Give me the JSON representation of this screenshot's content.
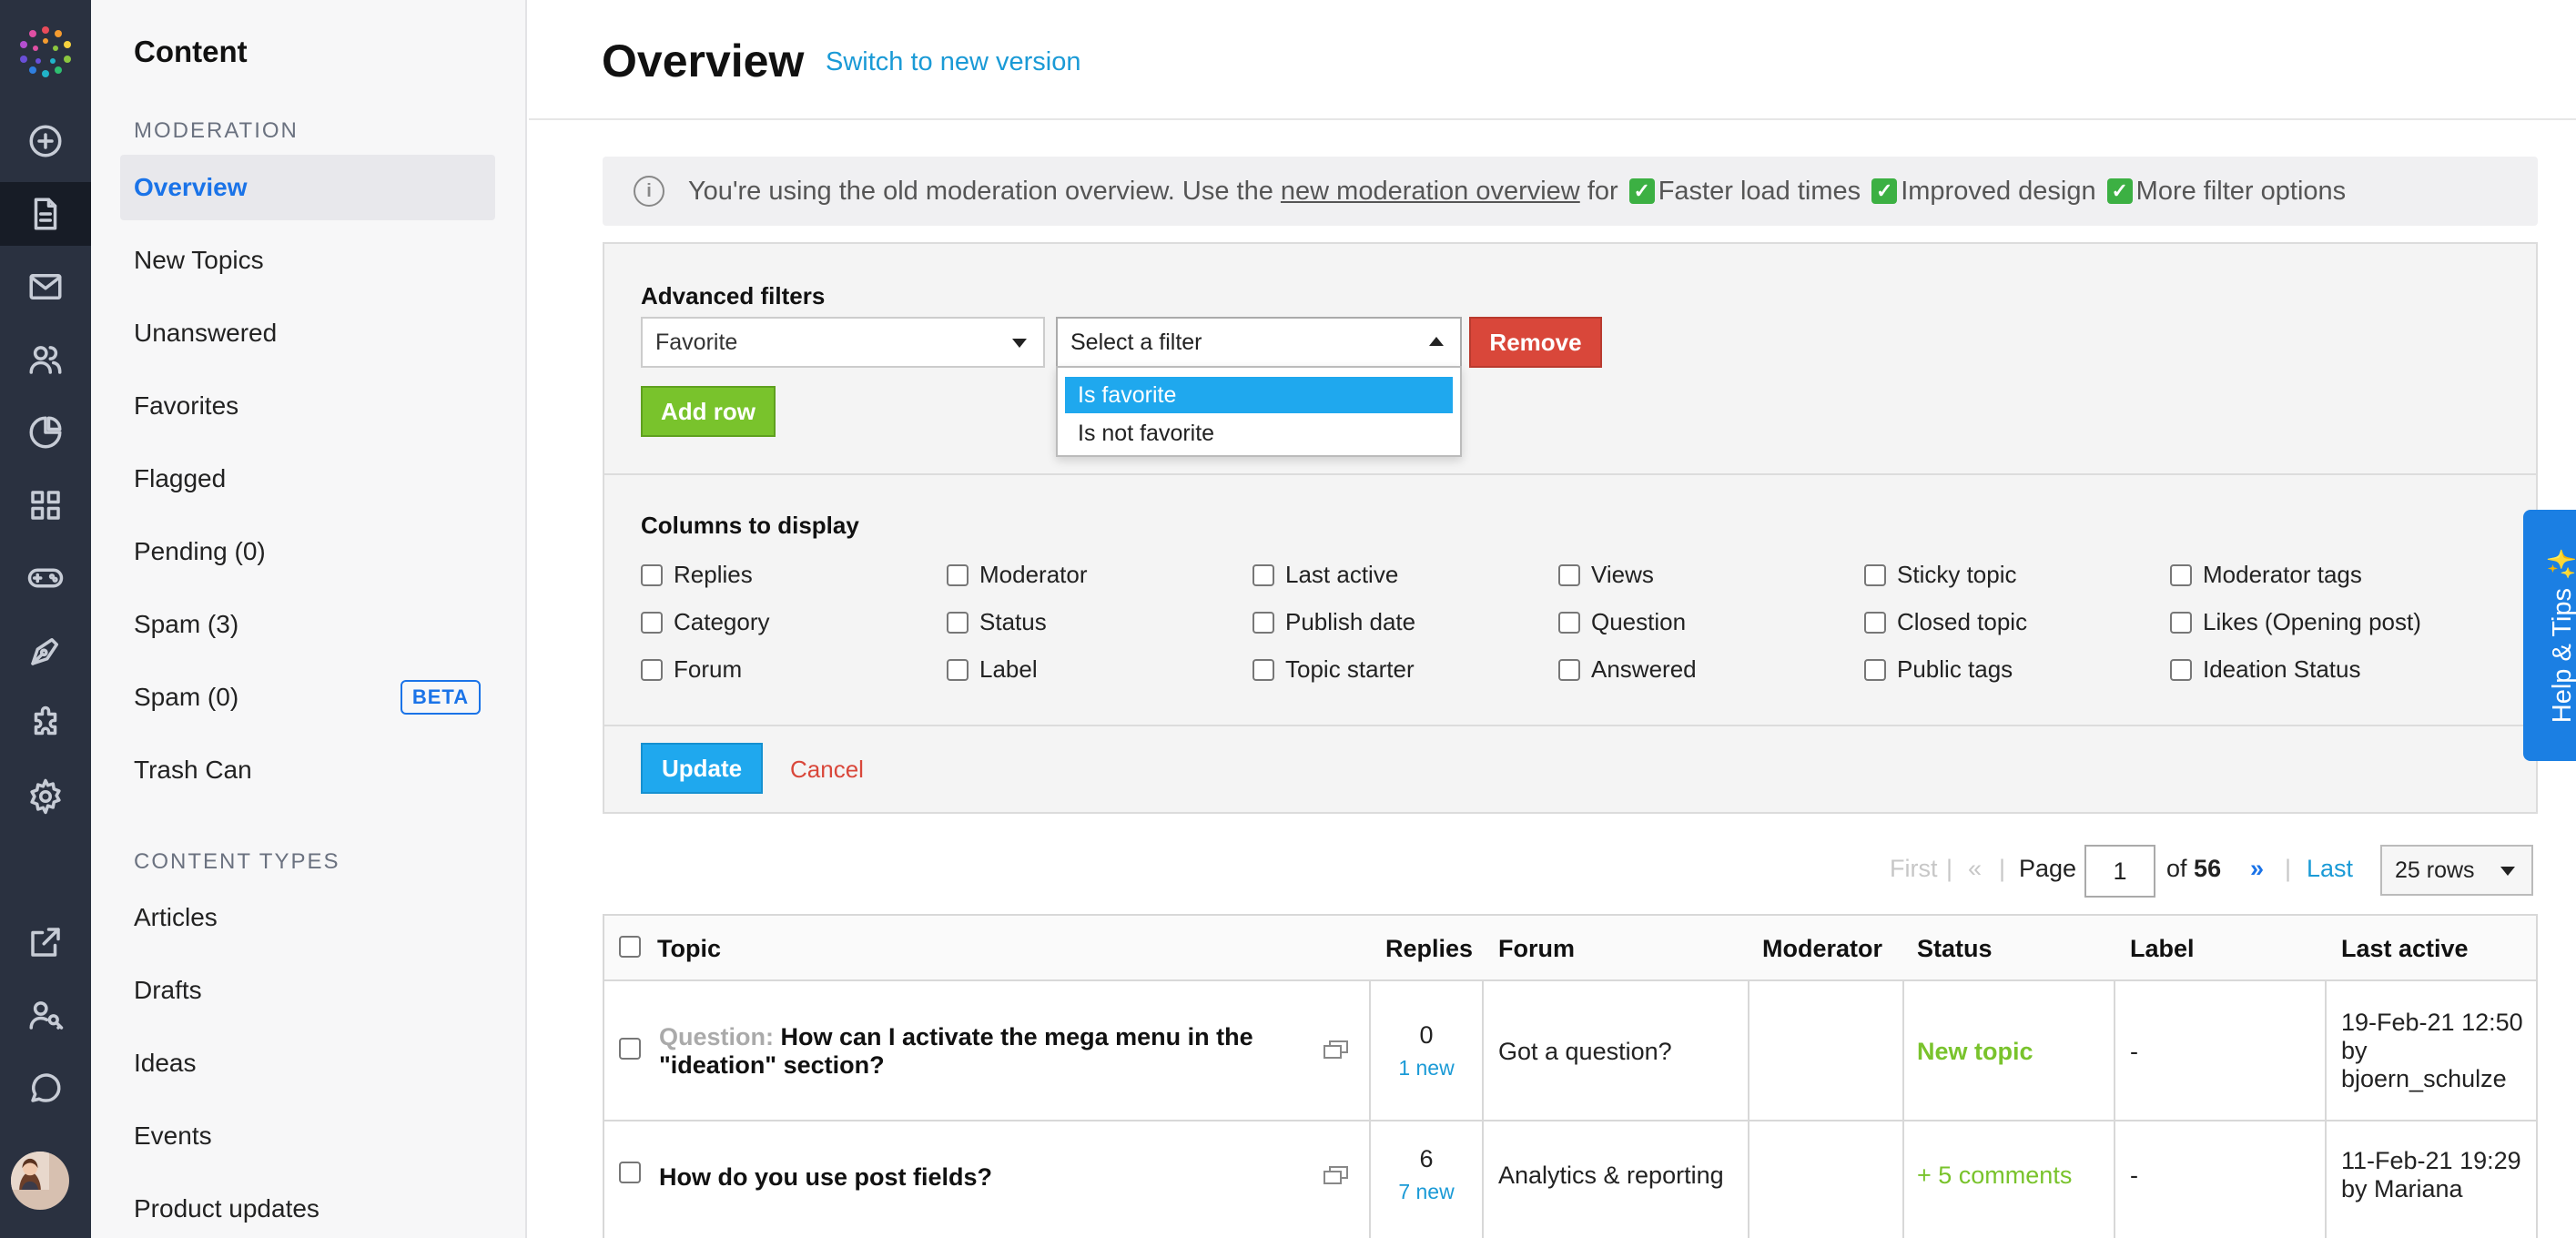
{
  "sidenav": {
    "title": "Content",
    "section_moderation": "MODERATION",
    "items": [
      {
        "label": "Overview"
      },
      {
        "label": "New Topics"
      },
      {
        "label": "Unanswered"
      },
      {
        "label": "Favorites"
      },
      {
        "label": "Flagged"
      },
      {
        "label": "Pending (0)"
      },
      {
        "label": "Spam (3)"
      },
      {
        "label": "Spam (0)",
        "badge": "BETA"
      },
      {
        "label": "Trash Can"
      }
    ],
    "section_types": "CONTENT TYPES",
    "types": [
      {
        "label": "Articles"
      },
      {
        "label": "Drafts"
      },
      {
        "label": "Ideas"
      },
      {
        "label": "Events"
      },
      {
        "label": "Product updates"
      }
    ]
  },
  "rail_icons": [
    "logo-icon",
    "plus-circle-icon",
    "document-icon",
    "mail-icon",
    "users-icon",
    "pie-chart-icon",
    "grid-icon",
    "gamepad-icon",
    "pen-icon",
    "puzzle-icon",
    "gear-icon",
    "external-link-icon",
    "user-key-icon",
    "chat-icon"
  ],
  "header": {
    "title": "Overview",
    "switch_link": "Switch to new version"
  },
  "notice": {
    "prefix": "You're using the old moderation overview. Use the",
    "link": "new moderation overview",
    "for": "for",
    "benefits": [
      "Faster load times",
      "Improved design",
      "More filter options"
    ],
    "check_glyph": "✓"
  },
  "filters": {
    "heading": "Advanced filters",
    "field_select": "Favorite",
    "value_select": "Select a filter",
    "options": [
      "Is favorite",
      "Is not favorite"
    ],
    "remove": "Remove",
    "add_row": "Add row",
    "columns_heading": "Columns to display",
    "columns": [
      [
        "Replies",
        "Category",
        "Forum"
      ],
      [
        "Moderator",
        "Status",
        "Label"
      ],
      [
        "Last active",
        "Publish date",
        "Topic starter"
      ],
      [
        "Views",
        "Question",
        "Answered"
      ],
      [
        "Sticky topic",
        "Closed topic",
        "Public tags"
      ],
      [
        "Moderator tags",
        "Likes (Opening post)",
        "Ideation Status"
      ]
    ],
    "update": "Update",
    "cancel": "Cancel"
  },
  "pager": {
    "first": "First",
    "prev": "«",
    "page_label": "Page",
    "page": "1",
    "of_label": "of",
    "total": "56",
    "next": "»",
    "last": "Last",
    "rows": "25 rows",
    "sep": "|"
  },
  "table": {
    "headers": [
      "Topic",
      "Replies",
      "Forum",
      "Moderator",
      "Status",
      "Label",
      "Last active"
    ],
    "rows": [
      {
        "prefix": "Question:",
        "topic": "How can I activate the mega menu in the \"ideation\" section?",
        "replies": "0",
        "new": "1 new",
        "forum": "Got a question?",
        "moderator": "",
        "status": "New topic",
        "label": "-",
        "last_active": "19-Feb-21 12:50 by bjoern_schulze"
      },
      {
        "prefix": "",
        "topic": "How do you use post fields?",
        "replies": "6",
        "new": "7 new",
        "forum": "Analytics & reporting",
        "moderator": "",
        "status": "+ 5 comments",
        "label": "-",
        "last_active": "11-Feb-21 19:29 by Mariana"
      }
    ]
  },
  "help_tab": "Help & Tips ✨"
}
